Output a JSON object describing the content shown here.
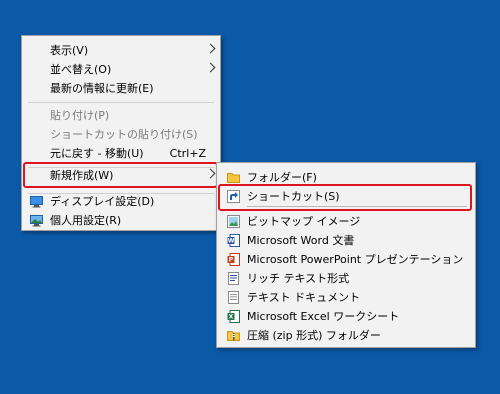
{
  "context_menu": {
    "items": [
      {
        "label": "表示(V)",
        "has_submenu": true
      },
      {
        "label": "並べ替え(O)",
        "has_submenu": true
      },
      {
        "label": "最新の情報に更新(E)"
      },
      {
        "label": "貼り付け(P)",
        "disabled": true
      },
      {
        "label": "ショートカットの貼り付け(S)",
        "disabled": true
      },
      {
        "label": "元に戻す - 移動(U)",
        "shortcut": "Ctrl+Z"
      },
      {
        "label": "新規作成(W)",
        "has_submenu": true,
        "highlighted": true
      },
      {
        "label": "ディスプレイ設定(D)",
        "icon": "display-settings-icon"
      },
      {
        "label": "個人用設定(R)",
        "icon": "personalize-icon"
      }
    ]
  },
  "submenu": {
    "items": [
      {
        "label": "フォルダー(F)",
        "icon": "folder-icon"
      },
      {
        "label": "ショートカット(S)",
        "icon": "shortcut-icon",
        "highlighted": true
      },
      {
        "label": "ビットマップ イメージ",
        "icon": "bitmap-icon"
      },
      {
        "label": "Microsoft Word 文書",
        "icon": "word-icon"
      },
      {
        "label": "Microsoft PowerPoint プレゼンテーション",
        "icon": "powerpoint-icon"
      },
      {
        "label": "リッチ テキスト形式",
        "icon": "rtf-icon"
      },
      {
        "label": "テキスト ドキュメント",
        "icon": "text-document-icon"
      },
      {
        "label": "Microsoft Excel ワークシート",
        "icon": "excel-icon"
      },
      {
        "label": "圧縮 (zip 形式) フォルダー",
        "icon": "zip-folder-icon"
      }
    ]
  },
  "colors": {
    "desktop": "#0b5aa8",
    "menu_bg": "#f2f2f2",
    "highlight": "#e0141e"
  }
}
